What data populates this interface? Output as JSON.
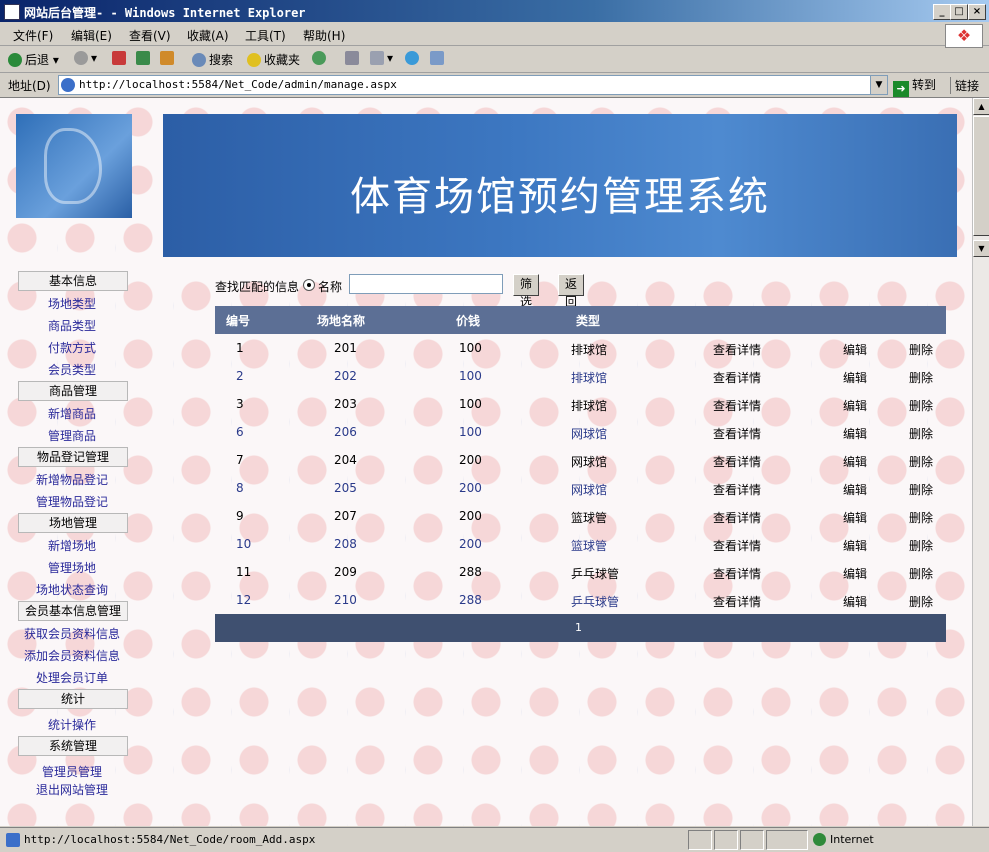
{
  "window": {
    "title": "网站后台管理- - Windows Internet Explorer",
    "min": "_",
    "max": "□",
    "close": "×"
  },
  "menu": [
    "文件(F)",
    "编辑(E)",
    "查看(V)",
    "收藏(A)",
    "工具(T)",
    "帮助(H)"
  ],
  "toolbar": {
    "back": "后退",
    "search": "搜索",
    "favorites": "收藏夹"
  },
  "address": {
    "label": "地址(D)",
    "url": "http://localhost:5584/Net_Code/admin/manage.aspx",
    "go": "转到",
    "links": "链接"
  },
  "banner": {
    "title": "体育场馆预约管理系统"
  },
  "sidebar": {
    "sections": [
      "基本信息",
      "商品管理",
      "物品登记管理",
      "场地管理",
      "会员基本信息管理",
      "统计",
      "系统管理"
    ],
    "links": {
      "basic": [
        "场地类型",
        "商品类型",
        "付款方式",
        "会员类型"
      ],
      "goods": [
        "新增商品",
        "管理商品"
      ],
      "items": [
        "新增物品登记",
        "管理物品登记"
      ],
      "venue": [
        "新增场地",
        "管理场地",
        "场地状态查询"
      ],
      "member": [
        "获取会员资料信息",
        "添加会员资料信息",
        "处理会员订单"
      ],
      "stats": [
        "统计操作"
      ],
      "system": [
        "管理员管理",
        "退出网站管理"
      ]
    }
  },
  "search": {
    "label": "查找匹配的信息",
    "radio_label": "名称",
    "value": "",
    "filter_btn": "筛选",
    "back_btn": "返回"
  },
  "table": {
    "headers": [
      "编号",
      "场地名称",
      "价钱",
      "类型"
    ],
    "action_labels": {
      "view": "查看详情",
      "edit": "编辑",
      "delete": "删除"
    },
    "rows": [
      {
        "id": "1",
        "name": "201",
        "price": "100",
        "type": "排球馆"
      },
      {
        "id": "2",
        "name": "202",
        "price": "100",
        "type": "排球馆"
      },
      {
        "id": "3",
        "name": "203",
        "price": "100",
        "type": "排球馆"
      },
      {
        "id": "6",
        "name": "206",
        "price": "100",
        "type": "网球馆"
      },
      {
        "id": "7",
        "name": "204",
        "price": "200",
        "type": "网球馆"
      },
      {
        "id": "8",
        "name": "205",
        "price": "200",
        "type": "网球馆"
      },
      {
        "id": "9",
        "name": "207",
        "price": "200",
        "type": "篮球管"
      },
      {
        "id": "10",
        "name": "208",
        "price": "200",
        "type": "篮球管"
      },
      {
        "id": "11",
        "name": "209",
        "price": "288",
        "type": "乒乓球管"
      },
      {
        "id": "12",
        "name": "210",
        "price": "288",
        "type": "乒乓球管"
      }
    ],
    "page": "1"
  },
  "status": {
    "url": "http://localhost:5584/Net_Code/room_Add.aspx",
    "zone": "Internet"
  }
}
